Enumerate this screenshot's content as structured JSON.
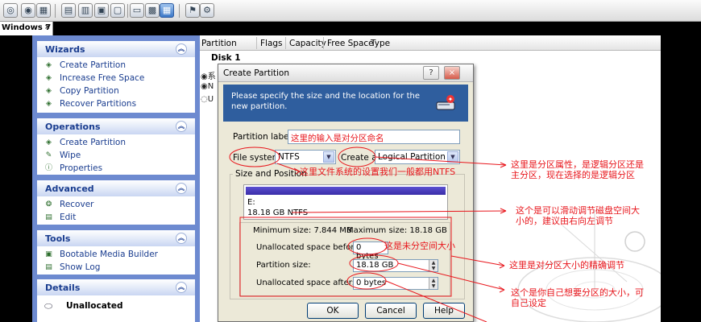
{
  "tab": {
    "label": "Windows 7",
    "close": "×"
  },
  "left": {
    "wizards": {
      "title": "Wizards",
      "items": [
        "Create Partition",
        "Increase Free Space",
        "Copy Partition",
        "Recover Partitions"
      ]
    },
    "operations": {
      "title": "Operations",
      "items": [
        "Create Partition",
        "Wipe",
        "Properties"
      ]
    },
    "advanced": {
      "title": "Advanced",
      "items": [
        "Recover",
        "Edit"
      ]
    },
    "tools": {
      "title": "Tools",
      "items": [
        "Bootable Media Builder",
        "Show Log"
      ]
    },
    "details": {
      "title": "Details",
      "value": "Unallocated"
    }
  },
  "disklist": {
    "columns": [
      "Partition",
      "Flags",
      "Capacity",
      "Free Space",
      "Type"
    ],
    "disk1": "Disk 1",
    "rows": [
      "系",
      "N",
      "U"
    ]
  },
  "dialog": {
    "title": "Create Partition",
    "help": "?",
    "close": "×",
    "header_text": "Please specify the size and the location for the new partition.",
    "partition_label_lbl": "Partition label:",
    "partition_label_value": "这里的输入是对分区命名",
    "file_system_lbl": "File system:",
    "file_system_value": "NTFS",
    "create_as_lbl": "Create as:",
    "create_as_value": "Logical Partition",
    "size_position_lbl": "Size and Position",
    "part_letter": "E:",
    "part_info": "18.18 GB  NTFS",
    "min_size": "Minimum size: 7.844 MB",
    "max_size": "Maximum size: 18.18 GB",
    "unalloc_before_lbl": "Unallocated space before:",
    "unalloc_before_value": "0 bytes",
    "partition_size_lbl": "Partition size:",
    "partition_size_value": "18.18 GB",
    "unalloc_after_lbl": "Unallocated space after:",
    "unalloc_after_value": "0 bytes",
    "ok": "OK",
    "cancel": "Cancel",
    "help_btn": "Help"
  },
  "annotations": {
    "fs": "这里文件系统的设置我们一般都用NTFS",
    "logical_1": "这里是分区属性，是逻辑分区还是",
    "logical_2": "主分区，现在选择的是逻辑分区",
    "slide_1": "这个是可以滑动调节磁盘空间大",
    "slide_2": "小的，建议由右向左调节",
    "unalloc": "这是未分空间大小",
    "size_precise": "这里是对分区大小的精确调节",
    "yourself_1": "这个是你自己想要分区的大小，可",
    "yourself_2": "自己设定"
  },
  "colors": {
    "annotation": "#e8161c",
    "header_bg": "#2f5e9e",
    "left_bg": "#6d8ad0"
  }
}
